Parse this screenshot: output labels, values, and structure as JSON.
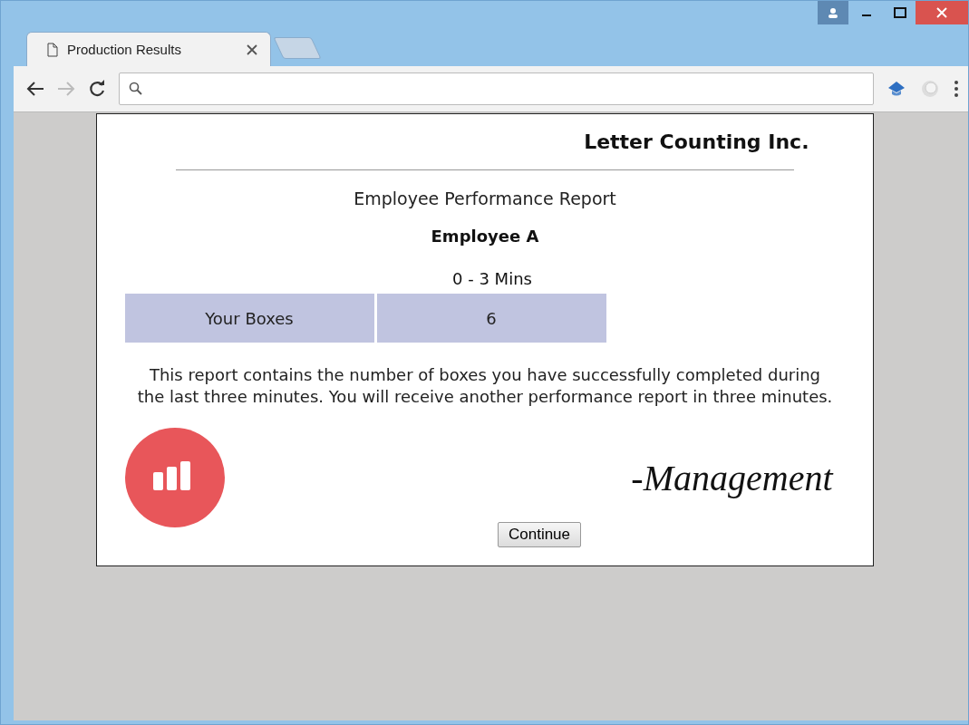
{
  "browser": {
    "tabs": [
      {
        "title": "Production Results",
        "selected": true
      }
    ]
  },
  "report": {
    "company": "Letter Counting Inc.",
    "title": "Employee Performance Report",
    "employee": "Employee A",
    "period": "0 - 3 Mins",
    "table": {
      "rows": [
        {
          "label": "Your Boxes",
          "value": "6"
        }
      ]
    },
    "message": "This report contains the number of boxes you have successfully completed during the last three minutes. You will receive another performance report in three minutes.",
    "signature": "-Management",
    "button": "Continue"
  }
}
